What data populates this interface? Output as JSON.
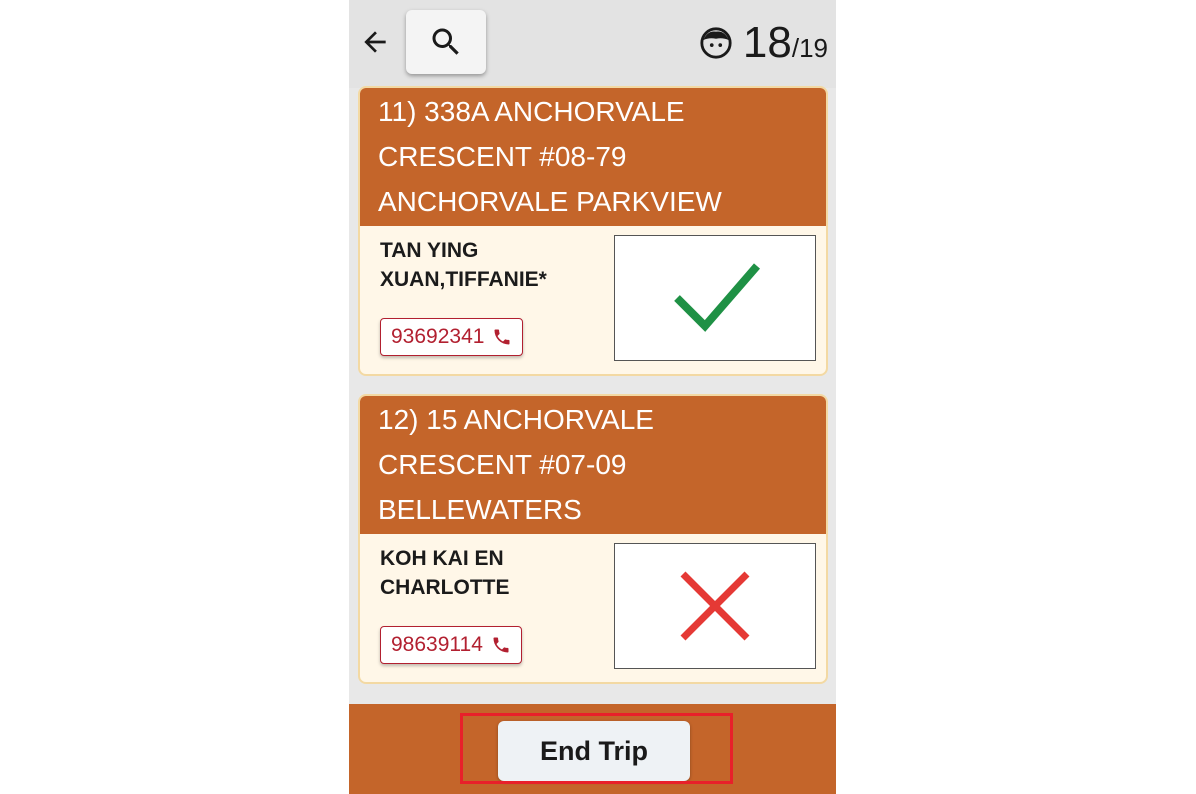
{
  "header": {
    "back_icon": "arrow-left-icon",
    "search_icon": "search-icon",
    "student_icon": "child-face-icon",
    "count_done": "18",
    "count_total": "/19"
  },
  "stops": [
    {
      "address_lines": [
        "11) 338A ANCHORVALE",
        "CRESCENT #08-79",
        "ANCHORVALE PARKVIEW"
      ],
      "name_lines": [
        "TAN YING",
        "XUAN,TIFFANIE*"
      ],
      "phone": "93692341",
      "status": "picked-up-check"
    },
    {
      "address_lines": [
        "12) 15 ANCHORVALE",
        "CRESCENT #07-09",
        "BELLEWATERS"
      ],
      "name_lines": [
        "KOH KAI EN",
        "CHARLOTTE"
      ],
      "phone": "98639114",
      "status": "absent-cross"
    }
  ],
  "footer": {
    "end_trip_label": "End Trip"
  },
  "colors": {
    "accent": "#c4652a",
    "check": "#1f9145",
    "cross": "#e53935",
    "phone": "#b22030",
    "highlight": "#e8202a"
  }
}
